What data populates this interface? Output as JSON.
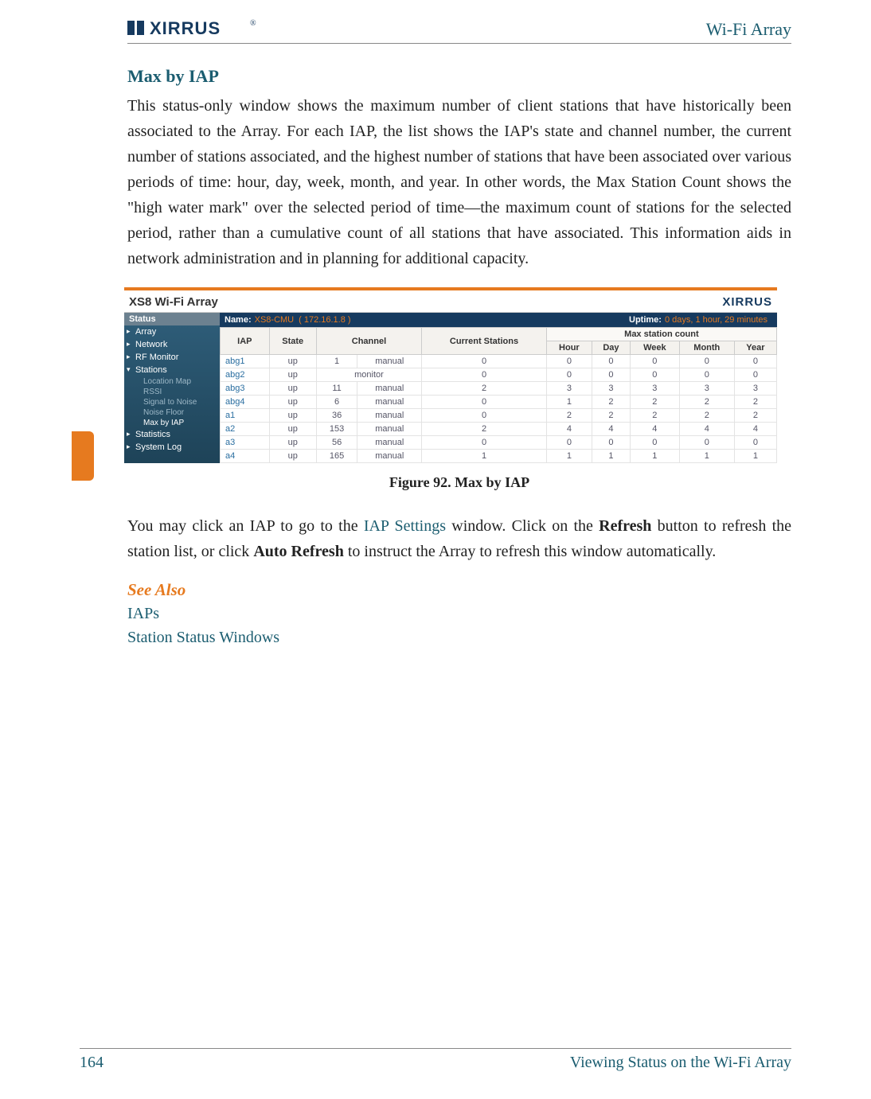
{
  "header": {
    "brand": "XIRRUS",
    "product": "Wi-Fi Array"
  },
  "section": {
    "title": "Max by IAP",
    "para1": "This status-only window shows the maximum number of client stations that have historically been associated to the Array. For each IAP, the list shows the IAP's state and channel number, the current number of stations associated, and the highest number of stations that have been associated over various periods of time: hour, day, week, month, and year. In other words, the Max Station Count shows the \"high water mark\" over the selected period of time—the maximum count of stations for the selected period, rather than a cumulative count of all stations that have associated. This information aids in network administration and in planning for additional capacity.",
    "para2_pre": "You may click an IAP to go to the ",
    "para2_link": "IAP Settings",
    "para2_mid": " window. Click on the ",
    "para2_bold1": "Refresh",
    "para2_mid2": " button to refresh the station list, or click ",
    "para2_bold2": "Auto Refresh",
    "para2_post": " to instruct the Array to refresh this window automatically."
  },
  "figure": {
    "caption": "Figure 92. Max by IAP"
  },
  "ui": {
    "title": "XS8 Wi-Fi Array",
    "logo": "XIRRUS",
    "sidebar": {
      "header": "Status",
      "items": [
        "Array",
        "Network",
        "RF Monitor",
        "Stations",
        "Statistics",
        "System Log"
      ],
      "subs": [
        "Location Map",
        "RSSI",
        "Signal to Noise",
        "Noise Floor",
        "Max by IAP"
      ]
    },
    "status": {
      "name_label": "Name:",
      "name_value": "XS8-CMU",
      "ip": "( 172.16.1.8 )",
      "uptime_label": "Uptime:",
      "uptime_value": "0 days, 1 hour, 29 minutes"
    },
    "table": {
      "group_header": "Max station count",
      "cols": [
        "IAP",
        "State",
        "Channel",
        "",
        "Current Stations",
        "Hour",
        "Day",
        "Week",
        "Month",
        "Year"
      ],
      "rows": [
        {
          "iap": "abg1",
          "state": "up",
          "chan": "1",
          "mode": "manual",
          "cur": "0",
          "hour": "0",
          "day": "0",
          "week": "0",
          "month": "0",
          "year": "0"
        },
        {
          "iap": "abg2",
          "state": "up",
          "chan": "monitor",
          "mode": "",
          "cur": "0",
          "hour": "0",
          "day": "0",
          "week": "0",
          "month": "0",
          "year": "0"
        },
        {
          "iap": "abg3",
          "state": "up",
          "chan": "11",
          "mode": "manual",
          "cur": "2",
          "hour": "3",
          "day": "3",
          "week": "3",
          "month": "3",
          "year": "3"
        },
        {
          "iap": "abg4",
          "state": "up",
          "chan": "6",
          "mode": "manual",
          "cur": "0",
          "hour": "1",
          "day": "2",
          "week": "2",
          "month": "2",
          "year": "2"
        },
        {
          "iap": "a1",
          "state": "up",
          "chan": "36",
          "mode": "manual",
          "cur": "0",
          "hour": "2",
          "day": "2",
          "week": "2",
          "month": "2",
          "year": "2"
        },
        {
          "iap": "a2",
          "state": "up",
          "chan": "153",
          "mode": "manual",
          "cur": "2",
          "hour": "4",
          "day": "4",
          "week": "4",
          "month": "4",
          "year": "4"
        },
        {
          "iap": "a3",
          "state": "up",
          "chan": "56",
          "mode": "manual",
          "cur": "0",
          "hour": "0",
          "day": "0",
          "week": "0",
          "month": "0",
          "year": "0"
        },
        {
          "iap": "a4",
          "state": "up",
          "chan": "165",
          "mode": "manual",
          "cur": "1",
          "hour": "1",
          "day": "1",
          "week": "1",
          "month": "1",
          "year": "1"
        }
      ]
    }
  },
  "see_also": {
    "title": "See Also",
    "links": [
      "IAPs",
      "Station Status Windows"
    ]
  },
  "footer": {
    "page": "164",
    "chapter": "Viewing Status on the Wi-Fi Array"
  }
}
